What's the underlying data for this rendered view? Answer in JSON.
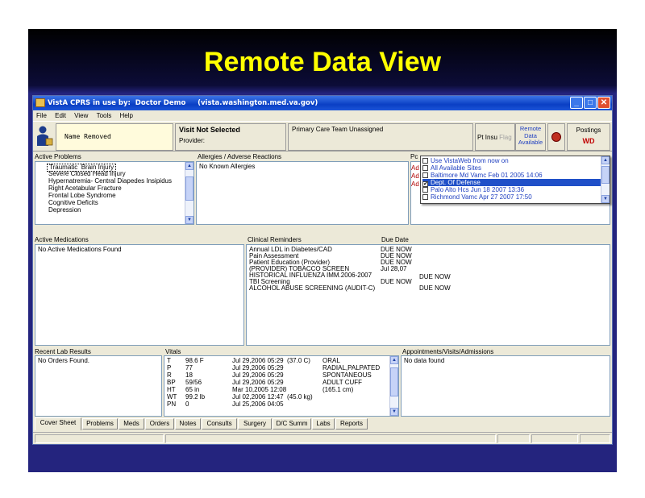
{
  "slide": {
    "title": "Remote Data View"
  },
  "window": {
    "title": "VistA CPRS in use by:  Doctor Demo     (vista.washington.med.va.gov)",
    "controls": {
      "minimize": "_",
      "maximize": "□",
      "close": "✕"
    }
  },
  "menu": [
    "File",
    "Edit",
    "View",
    "Tools",
    "Help"
  ],
  "header": {
    "patient_name": "Name Removed",
    "visit_title": "Visit Not Selected",
    "visit_provider": "Provider:",
    "team": "Primary Care Team Unassigned",
    "pt_ins": "Pt Insu",
    "flag": "Flag",
    "remote_line1": "Remote",
    "remote_line2": "Data",
    "remote_line3": "Available",
    "postings_label": "Postings",
    "postings_value": "WD"
  },
  "active_problems": {
    "label": "Active Problems",
    "items": [
      "Traumatic  Brain Injury",
      "Severe Closed Head Injury",
      "Hypernatremia- Central Diapedes Insipidus",
      "Right Acetabular Fracture",
      "Frontal Lobe Syndrome",
      "Cognitive Deficits",
      "Depression"
    ]
  },
  "allergies": {
    "label": "Allergies / Adverse Reactions",
    "items": [
      "No Known Allergies"
    ]
  },
  "remote_sites": {
    "label": "Pc",
    "left_fragments": [
      "Ad",
      "Ad",
      "Ad"
    ],
    "items": [
      {
        "text": "Use VistaWeb from now on",
        "checked": false
      },
      {
        "text": "All Available Sites",
        "checked": false
      },
      {
        "text": "Baltimore Md Vamc Feb 01 2005 14:06",
        "checked": false
      },
      {
        "text": "Dept. Of Defense",
        "checked": true
      },
      {
        "text": "Palo Alto Hcs        Jun 18 2007 13:36",
        "checked": false
      },
      {
        "text": "Richmond Vamc    Apr 27 2007 17:50",
        "checked": false
      }
    ]
  },
  "active_medications": {
    "label": "Active Medications",
    "items": [
      "No Active Medications Found"
    ]
  },
  "clinical_reminders": {
    "label": "Clinical Reminders",
    "due_label": "Due Date",
    "items": [
      {
        "name": "Annual LDL in Diabetes/CAD",
        "due": "DUE NOW"
      },
      {
        "name": "Pain Assessment",
        "due": "DUE NOW"
      },
      {
        "name": "Patient Education (Provider)",
        "due": "DUE NOW"
      },
      {
        "name": "(PROVIDER) TOBACCO SCREEN",
        "due": "Jul 28,07"
      },
      {
        "name": "HISTORICAL INFLUENZA IMM.2006-2007",
        "due": "DUE NOW"
      },
      {
        "name": "TBI Screening",
        "due": "DUE NOW"
      },
      {
        "name": "ALCOHOL ABUSE SCREENING (AUDIT-C)",
        "due": "DUE NOW"
      }
    ]
  },
  "recent_labs": {
    "label": "Recent Lab Results",
    "items": [
      "No Orders Found."
    ]
  },
  "vitals": {
    "label": "Vitals",
    "rows": [
      {
        "code": "T",
        "value": "98.6 F",
        "date": "Jul 29,2006 05:29  (37.0 C)",
        "note": "ORAL"
      },
      {
        "code": "P",
        "value": "77",
        "date": "Jul 29,2006 05:29",
        "note": "RADIAL,PALPATED"
      },
      {
        "code": "R",
        "value": "18",
        "date": "Jul 29,2006 05:29",
        "note": "SPONTANEOUS"
      },
      {
        "code": "BP",
        "value": "59/56",
        "date": "Jul 29,2006 05:29",
        "note": "ADULT CUFF"
      },
      {
        "code": "HT",
        "value": "65 in",
        "date": "Mar 10,2005 12:08",
        "note": "(165.1 cm)"
      },
      {
        "code": "WT",
        "value": "99.2 lb",
        "date": "Jul 02,2006 12:47  (45.0 kg)",
        "note": ""
      },
      {
        "code": "PN",
        "value": "0",
        "date": "Jul 25,2006 04:05",
        "note": ""
      }
    ]
  },
  "appointments": {
    "label": "Appointments/Visits/Admissions",
    "items": [
      "No data found"
    ]
  },
  "tabs": [
    "Cover Sheet",
    "Problems",
    "Meds",
    "Orders",
    "Notes",
    "Consults",
    "Surgery",
    "D/C Summ",
    "Labs",
    "Reports"
  ],
  "colors": {
    "slide_bg": "#24247e",
    "title_color": "#ffff00",
    "titlebar": "#0a3fc4",
    "selected_row": "#2050c8"
  },
  "icons": {
    "patient": "person-icon",
    "alarm": "alarm-clock-icon",
    "app": "vista-cprs-icon"
  }
}
